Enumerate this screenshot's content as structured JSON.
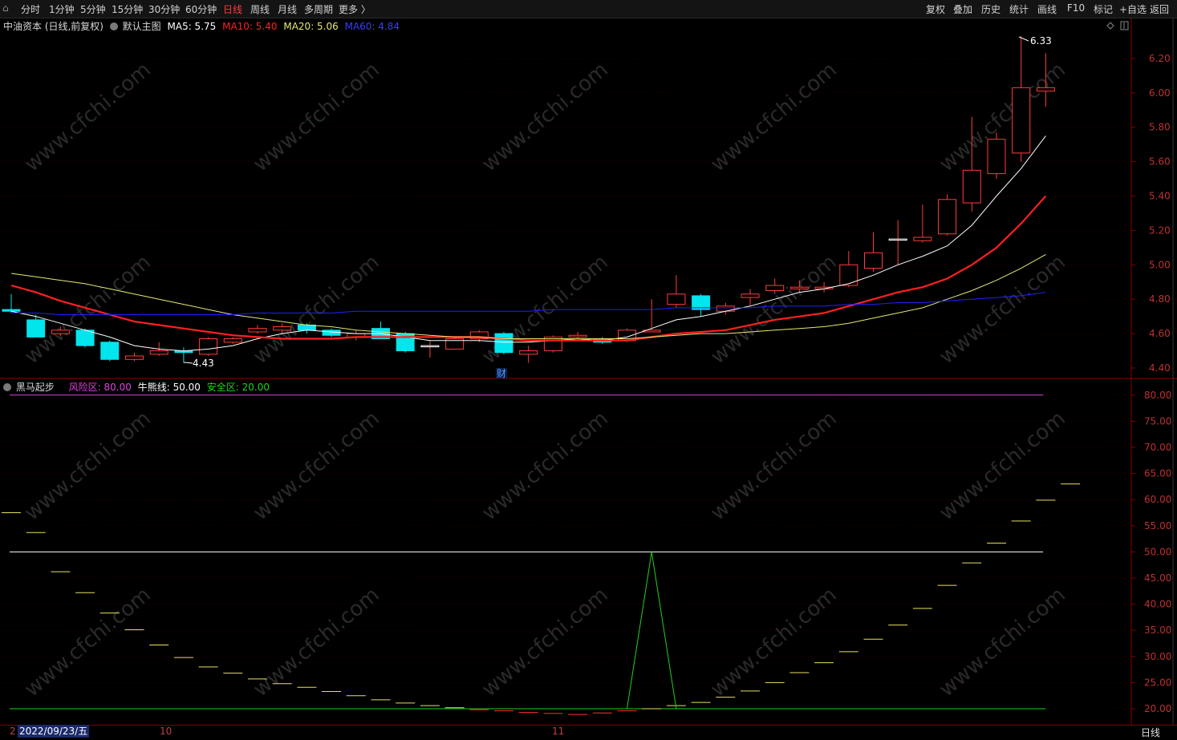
{
  "toolbar": {
    "menu_glyph": "⌂",
    "left": [
      "分时",
      "1分钟",
      "5分钟",
      "15分钟",
      "30分钟",
      "60分钟",
      "日线",
      "周线",
      "月线",
      "多周期",
      "更多 〉"
    ],
    "active": "日线",
    "right": [
      "复权",
      "叠加",
      "历史",
      "统计",
      "画线",
      "F10",
      "标记",
      "+自选",
      "返回"
    ]
  },
  "main_panel": {
    "stock_label": "中油资本 (日线,前复权)",
    "template_label": "默认主图",
    "ma5_label": "MA5: 5.75",
    "ma10_label": "MA10: 5.40",
    "ma20_label": "MA20: 5.06",
    "ma60_label": "MA60: 4.84",
    "high_label": "6.33",
    "low_label": "4.43",
    "event_marker": "财",
    "colors": {
      "ma5": "#ffffff",
      "ma10": "#ff2020",
      "ma20": "#e8e870",
      "ma60": "#2020ff",
      "up": "#ff3c3c",
      "down": "#00e5ee"
    }
  },
  "indicator_panel": {
    "name": "黑马起步",
    "risk_label": "风险区: 80.00",
    "bull_bear_label": "牛熊线: 50.00",
    "safe_label": "安全区: 20.00",
    "colors": {
      "risk": "#e040e0",
      "bull_bear": "#ffffff",
      "safe": "#20d020",
      "signal": "#20d020",
      "steps": "#e8e060",
      "low_steps": "#ff3030"
    }
  },
  "bottom": {
    "date": "2022/09/23/五",
    "period": "日线",
    "start_mark": "2",
    "months": [
      "10",
      "11"
    ]
  },
  "watermark": "www.cfchi.com",
  "chart_data": [
    {
      "type": "candlestick",
      "title": "中油资本 (日线,前复权)",
      "ylim": [
        4.35,
        6.42
      ],
      "y_ticks": [
        "6.20",
        "6.00",
        "5.80",
        "5.60",
        "5.40",
        "5.20",
        "5.00",
        "4.80",
        "4.60",
        "4.40"
      ],
      "candles": [
        {
          "o": 4.74,
          "c": 4.73,
          "h": 4.83,
          "l": 4.72
        },
        {
          "o": 4.68,
          "c": 4.58,
          "h": 4.71,
          "l": 4.58
        },
        {
          "o": 4.6,
          "c": 4.62,
          "h": 4.64,
          "l": 4.59
        },
        {
          "o": 4.62,
          "c": 4.53,
          "h": 4.63,
          "l": 4.52
        },
        {
          "o": 4.55,
          "c": 4.45,
          "h": 4.56,
          "l": 4.44
        },
        {
          "o": 4.45,
          "c": 4.47,
          "h": 4.49,
          "l": 4.44
        },
        {
          "o": 4.48,
          "c": 4.5,
          "h": 4.55,
          "l": 4.47
        },
        {
          "o": 4.5,
          "c": 4.49,
          "h": 4.52,
          "l": 4.43
        },
        {
          "o": 4.48,
          "c": 4.57,
          "h": 4.58,
          "l": 4.47
        },
        {
          "o": 4.55,
          "c": 4.57,
          "h": 4.58,
          "l": 4.54
        },
        {
          "o": 4.61,
          "c": 4.63,
          "h": 4.65,
          "l": 4.6
        },
        {
          "o": 4.62,
          "c": 4.64,
          "h": 4.66,
          "l": 4.6
        },
        {
          "o": 4.65,
          "c": 4.62,
          "h": 4.66,
          "l": 4.6
        },
        {
          "o": 4.62,
          "c": 4.59,
          "h": 4.63,
          "l": 4.58
        },
        {
          "o": 4.58,
          "c": 4.6,
          "h": 4.62,
          "l": 4.56
        },
        {
          "o": 4.63,
          "c": 4.57,
          "h": 4.67,
          "l": 4.57
        },
        {
          "o": 4.6,
          "c": 4.5,
          "h": 4.61,
          "l": 4.49
        },
        {
          "o": 4.53,
          "c": 4.53,
          "h": 4.56,
          "l": 4.46
        },
        {
          "o": 4.51,
          "c": 4.57,
          "h": 4.58,
          "l": 4.51
        },
        {
          "o": 4.57,
          "c": 4.61,
          "h": 4.62,
          "l": 4.55
        },
        {
          "o": 4.6,
          "c": 4.49,
          "h": 4.61,
          "l": 4.48
        },
        {
          "o": 4.48,
          "c": 4.5,
          "h": 4.53,
          "l": 4.43
        },
        {
          "o": 4.5,
          "c": 4.58,
          "h": 4.59,
          "l": 4.49
        },
        {
          "o": 4.58,
          "c": 4.59,
          "h": 4.61,
          "l": 4.57
        },
        {
          "o": 4.57,
          "c": 4.55,
          "h": 4.58,
          "l": 4.54
        },
        {
          "o": 4.56,
          "c": 4.62,
          "h": 4.63,
          "l": 4.55
        },
        {
          "o": 4.61,
          "c": 4.62,
          "h": 4.8,
          "l": 4.61
        },
        {
          "o": 4.77,
          "c": 4.83,
          "h": 4.94,
          "l": 4.75
        },
        {
          "o": 4.82,
          "c": 4.74,
          "h": 4.83,
          "l": 4.7
        },
        {
          "o": 4.73,
          "c": 4.76,
          "h": 4.78,
          "l": 4.71
        },
        {
          "o": 4.81,
          "c": 4.83,
          "h": 4.86,
          "l": 4.76
        },
        {
          "o": 4.85,
          "c": 4.88,
          "h": 4.92,
          "l": 4.83
        },
        {
          "o": 4.86,
          "c": 4.87,
          "h": 4.91,
          "l": 4.84
        },
        {
          "o": 4.86,
          "c": 4.87,
          "h": 4.9,
          "l": 4.84
        },
        {
          "o": 4.88,
          "c": 5.0,
          "h": 5.08,
          "l": 4.87
        },
        {
          "o": 4.98,
          "c": 5.07,
          "h": 5.19,
          "l": 4.96
        },
        {
          "o": 5.15,
          "c": 5.15,
          "h": 5.26,
          "l": 5.0
        },
        {
          "o": 5.14,
          "c": 5.16,
          "h": 5.35,
          "l": 5.13
        },
        {
          "o": 5.18,
          "c": 5.38,
          "h": 5.41,
          "l": 5.17
        },
        {
          "o": 5.36,
          "c": 5.55,
          "h": 5.86,
          "l": 5.31
        },
        {
          "o": 5.53,
          "c": 5.73,
          "h": 5.77,
          "l": 5.5
        },
        {
          "o": 5.65,
          "c": 6.03,
          "h": 6.33,
          "l": 5.6
        },
        {
          "o": 6.01,
          "c": 6.03,
          "h": 6.23,
          "l": 5.92
        }
      ],
      "series": [
        {
          "name": "MA5",
          "values": [
            4.73,
            4.7,
            4.66,
            4.62,
            4.58,
            4.53,
            4.51,
            4.5,
            4.51,
            4.53,
            4.57,
            4.6,
            4.62,
            4.61,
            4.6,
            4.6,
            4.58,
            4.56,
            4.56,
            4.56,
            4.55,
            4.55,
            4.56,
            4.57,
            4.56,
            4.58,
            4.63,
            4.68,
            4.7,
            4.73,
            4.76,
            4.8,
            4.84,
            4.86,
            4.89,
            4.94,
            5.0,
            5.05,
            5.11,
            5.23,
            5.4,
            5.56,
            5.75
          ]
        },
        {
          "name": "MA10",
          "values": [
            4.88,
            4.84,
            4.79,
            4.75,
            4.71,
            4.67,
            4.65,
            4.63,
            4.61,
            4.59,
            4.58,
            4.57,
            4.57,
            4.57,
            4.58,
            4.58,
            4.58,
            4.58,
            4.58,
            4.58,
            4.57,
            4.56,
            4.56,
            4.56,
            4.56,
            4.56,
            4.58,
            4.6,
            4.61,
            4.62,
            4.65,
            4.68,
            4.7,
            4.72,
            4.76,
            4.8,
            4.84,
            4.87,
            4.92,
            5.0,
            5.1,
            5.24,
            5.4
          ]
        },
        {
          "name": "MA20",
          "values": [
            4.95,
            4.93,
            4.91,
            4.89,
            4.86,
            4.83,
            4.8,
            4.77,
            4.74,
            4.71,
            4.69,
            4.67,
            4.65,
            4.64,
            4.62,
            4.61,
            4.6,
            4.59,
            4.58,
            4.58,
            4.57,
            4.57,
            4.57,
            4.57,
            4.57,
            4.57,
            4.58,
            4.59,
            4.6,
            4.6,
            4.61,
            4.62,
            4.63,
            4.64,
            4.66,
            4.69,
            4.72,
            4.75,
            4.8,
            4.85,
            4.91,
            4.98,
            5.06
          ]
        },
        {
          "name": "MA60",
          "values": [
            4.72,
            4.72,
            4.71,
            4.71,
            4.71,
            4.71,
            4.71,
            4.71,
            4.71,
            4.71,
            4.72,
            4.72,
            4.72,
            4.72,
            4.73,
            4.73,
            4.73,
            4.73,
            4.73,
            4.73,
            4.73,
            4.73,
            4.74,
            4.74,
            4.74,
            4.74,
            4.74,
            4.75,
            4.75,
            4.75,
            4.75,
            4.76,
            4.76,
            4.76,
            4.77,
            4.77,
            4.78,
            4.78,
            4.79,
            4.8,
            4.81,
            4.82,
            4.84
          ]
        }
      ]
    },
    {
      "type": "line",
      "title": "黑马起步",
      "ylim": [
        17.5,
        82.5
      ],
      "y_ticks": [
        "80.00",
        "75.00",
        "70.00",
        "65.00",
        "60.00",
        "55.00",
        "50.00",
        "45.00",
        "40.00",
        "35.00",
        "30.00",
        "25.00",
        "20.00"
      ],
      "reference_lines": [
        {
          "name": "风险区",
          "value": 80
        },
        {
          "name": "牛熊线",
          "value": 50
        },
        {
          "name": "安全区",
          "value": 20
        }
      ],
      "steps": [
        57.5,
        53.7,
        46.2,
        42.2,
        38.3,
        35.1,
        32.2,
        29.8,
        28.0,
        26.8,
        25.7,
        24.8,
        24.1,
        23.3,
        22.5,
        21.7,
        21.1,
        20.6,
        20.2,
        19.8,
        19.6,
        19.3,
        19.1,
        18.9,
        19.2,
        19.6,
        20.0,
        20.6,
        21.2,
        22.2,
        23.4,
        25.0,
        26.9,
        28.8,
        30.9,
        33.3,
        36.0,
        39.2,
        43.6,
        47.9,
        51.7,
        55.9,
        59.9,
        63.0
      ],
      "signal": [
        20,
        20,
        20,
        20,
        20,
        20,
        20,
        20,
        20,
        20,
        20,
        20,
        20,
        20,
        20,
        20,
        20,
        20,
        20,
        20,
        20,
        20,
        20,
        20,
        20,
        20,
        50,
        20,
        20,
        20,
        20,
        20,
        20,
        20,
        20,
        20,
        20,
        20,
        20,
        20,
        20,
        20,
        20
      ]
    }
  ]
}
